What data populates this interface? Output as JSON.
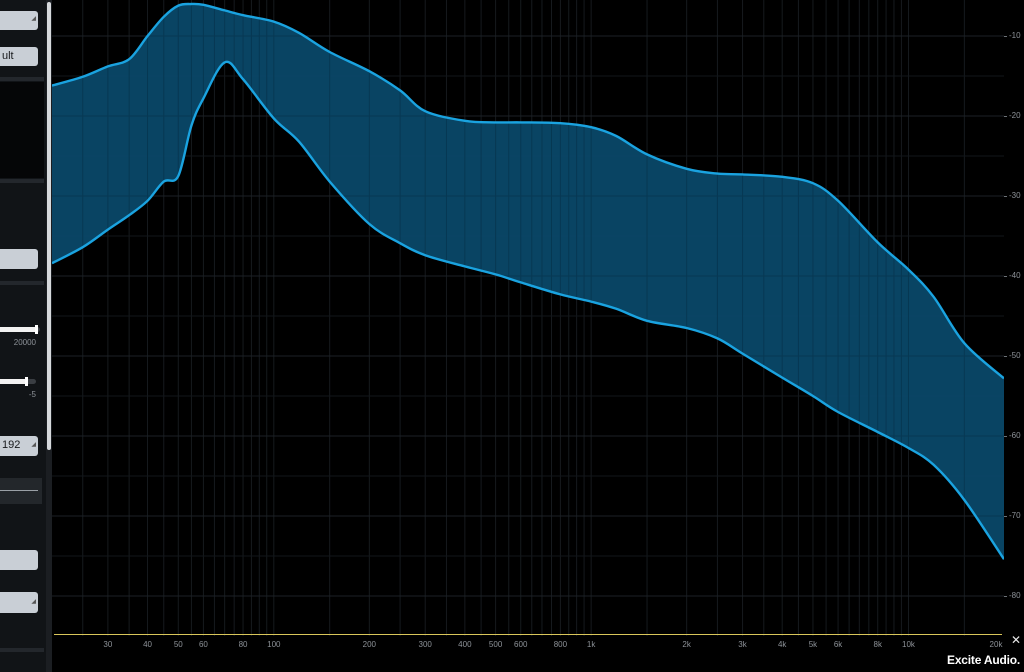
{
  "panel": {
    "dropdown_top": {
      "label": ""
    },
    "mode_button": {
      "label": "ult"
    },
    "middle_button": {
      "label": ""
    },
    "slider_freq": {
      "value_label": "20000",
      "fill_fraction": 0.97
    },
    "slider_gain": {
      "value_label": "-5",
      "fill_fraction": 0.72
    },
    "fft_select": {
      "label": "192"
    },
    "bottom_button_1": {
      "label": ""
    },
    "bottom_button_2": {
      "label": ""
    }
  },
  "spectrum": {
    "x_axis_labels": [
      "30",
      "40",
      "50",
      "60",
      "80",
      "100",
      "200",
      "300",
      "400",
      "500",
      "600",
      "800",
      "1k",
      "2k",
      "3k",
      "4k",
      "5k",
      "6k",
      "8k",
      "10k",
      "20k"
    ],
    "y_axis_labels": [
      "-10",
      "-20",
      "-30",
      "-40",
      "-50",
      "-60",
      "-70",
      "-80"
    ],
    "fill_color": "#0a4a6b",
    "line_color": "#1aa3e0",
    "marker_line_color": "#d9c65a"
  },
  "chart_data": {
    "type": "area",
    "xscale": "log",
    "xlim": [
      20,
      20000
    ],
    "ylim": [
      -85,
      -5.5
    ],
    "xlabel": "",
    "ylabel": "",
    "grid": true,
    "series": [
      {
        "x": [
          20,
          25,
          30,
          35,
          40,
          45,
          50,
          55,
          60,
          70,
          80,
          100,
          120,
          150,
          200,
          250,
          300,
          400,
          500,
          600,
          800,
          1000,
          1200,
          1500,
          2000,
          2500,
          3000,
          4000,
          5000,
          6000,
          8000,
          10000,
          12000,
          15000,
          20000
        ],
        "values": [
          -16.2,
          -15.1,
          -13.8,
          -12.9,
          -10.0,
          -7.6,
          -6.2,
          -6.0,
          -6.1,
          -6.8,
          -7.4,
          -8.2,
          -9.6,
          -12.0,
          -14.4,
          -16.8,
          -19.4,
          -20.6,
          -20.8,
          -20.8,
          -20.9,
          -21.4,
          -22.5,
          -24.8,
          -26.6,
          -27.2,
          -27.3,
          -27.6,
          -28.4,
          -30.6,
          -35.8,
          -39.2,
          -42.6,
          -48.4,
          -52.8
        ]
      },
      {
        "x": [
          20,
          25,
          30,
          35,
          40,
          45,
          50,
          55,
          60,
          70,
          80,
          100,
          120,
          150,
          200,
          250,
          300,
          400,
          500,
          600,
          800,
          1000,
          1200,
          1500,
          2000,
          2500,
          3000,
          4000,
          5000,
          6000,
          8000,
          10000,
          12000,
          15000,
          20000
        ],
        "values": [
          -38.4,
          -36.4,
          -34.2,
          -32.4,
          -30.6,
          -28.2,
          -27.5,
          -21.2,
          -17.8,
          -13.3,
          -15.4,
          -20.3,
          -23.2,
          -28.2,
          -33.5,
          -35.9,
          -37.4,
          -38.8,
          -39.8,
          -40.8,
          -42.3,
          -43.2,
          -44.1,
          -45.6,
          -46.5,
          -47.8,
          -49.7,
          -52.7,
          -55.0,
          -57.0,
          -59.5,
          -61.5,
          -63.6,
          -68.0,
          -75.4
        ]
      }
    ]
  },
  "brand": {
    "label": "Excite Audio."
  }
}
